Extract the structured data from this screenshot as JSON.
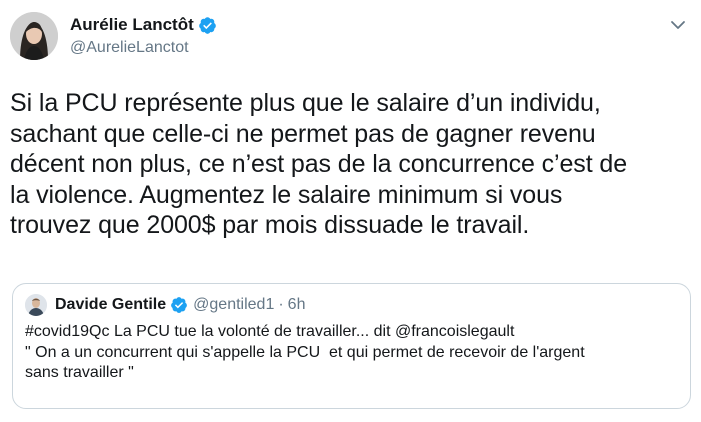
{
  "author": {
    "display_name": "Aurélie Lanctôt",
    "handle": "@AurelieLanctot",
    "verified": true
  },
  "icons": {
    "verified": "verified-badge-icon",
    "menu": "chevron-down-icon"
  },
  "tweet": {
    "lines": [
      "Si la PCU représente plus que le salaire d’un individu,",
      "sachant que celle-ci ne permet pas de gagner revenu",
      "décent non plus, ce n’est pas de la concurrence c’est de",
      "la violence. Augmentez le salaire minimum si vous",
      "trouvez que 2000$ par mois dissuade le travail."
    ]
  },
  "quoted": {
    "display_name": "Davide Gentile",
    "handle": "@gentiled1",
    "separator": "·",
    "time": "6h",
    "verified": true,
    "lines": [
      "#covid19Qc La PCU tue la volonté de travailler... dit @francoislegault",
      "\" On a un concurrent qui s'appelle la PCU  et qui permet de recevoir de l'argent",
      "sans travailler \""
    ]
  },
  "colors": {
    "verified_blue": "#1da1f2",
    "muted_text": "#657786",
    "border": "#ccd6dd"
  }
}
